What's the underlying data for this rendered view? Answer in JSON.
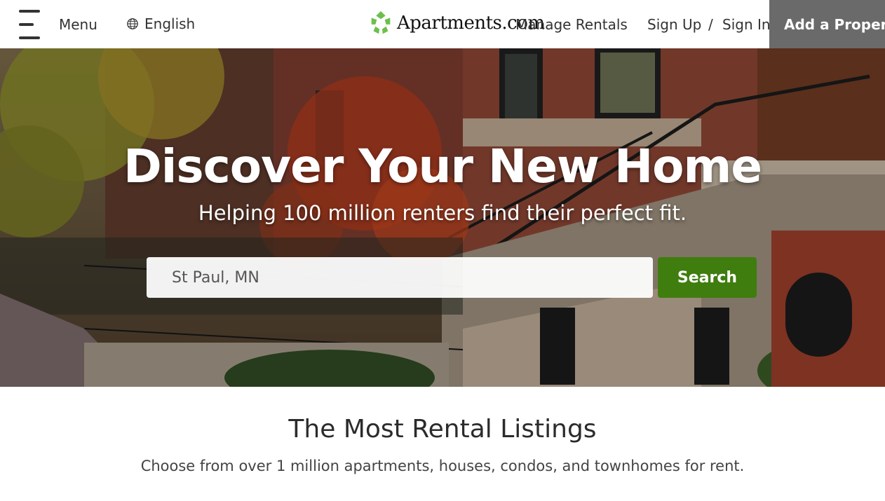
{
  "header": {
    "menu_label": "Menu",
    "language_label": "English",
    "logo_text": "Apartments.com",
    "nav": {
      "manage_rentals": "Manage Rentals",
      "sign_up": "Sign Up",
      "separator": "/",
      "sign_in": "Sign In",
      "add_property": "Add a Property"
    }
  },
  "hero": {
    "title": "Discover Your New Home",
    "subtitle": "Helping 100 million renters find their perfect fit.",
    "search_value": "St Paul, MN",
    "search_button": "Search"
  },
  "listings": {
    "title": "The Most Rental Listings",
    "subtitle": "Choose from over 1 million apartments, houses, condos, and townhomes for rent."
  },
  "icons": {
    "menu": "hamburger-icon",
    "language": "globe-icon",
    "logo": "apartments-logo-icon"
  },
  "colors": {
    "brand_green": "#3f7d0e",
    "add_property_bg": "#6a6a6a",
    "logo_green": "#6cc04a"
  }
}
